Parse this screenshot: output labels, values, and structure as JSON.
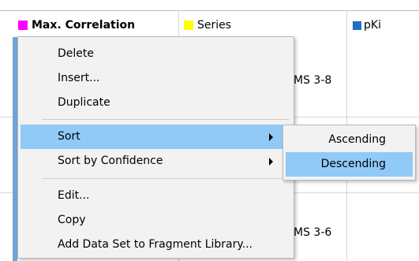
{
  "columns": [
    {
      "label": "Max. Correlation",
      "color": "#ff00ff"
    },
    {
      "label": "Series",
      "color": "#ffff00"
    },
    {
      "label": "pKi",
      "color": "#1f6fc4"
    }
  ],
  "rows": [
    {
      "series": "MS 3-8"
    },
    {
      "series": "MS 3-6"
    }
  ],
  "context_menu": {
    "items": [
      {
        "label": "Delete"
      },
      {
        "label": "Insert..."
      },
      {
        "label": "Duplicate"
      },
      {
        "label": "Sort"
      },
      {
        "label": "Sort by Confidence"
      },
      {
        "label": "Edit..."
      },
      {
        "label": "Copy"
      },
      {
        "label": "Add Data Set to Fragment Library..."
      }
    ]
  },
  "sort_submenu": {
    "items": [
      {
        "label": "Ascending"
      },
      {
        "label": "Descending"
      }
    ]
  },
  "colors": {
    "menu_background": "#f2f2f2",
    "highlight": "#91c9f7",
    "row_strip": "#6fa5d6"
  }
}
